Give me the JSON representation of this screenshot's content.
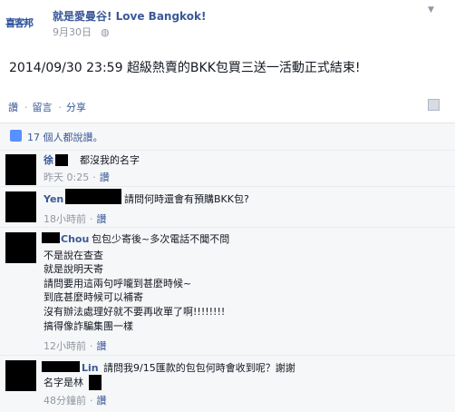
{
  "post": {
    "logo_text": "喜客邦",
    "page_name": "就是愛曼谷! Love Bangkok!",
    "date": "9月30日",
    "text": "2014/09/30 23:59 超級熱賣的BKK包買三送一活動正式結束!"
  },
  "actions": {
    "like": "讚",
    "comment": "留言",
    "share": "分享",
    "dot": "·"
  },
  "likes": {
    "count_text": "17 個人都說讚。"
  },
  "comments": [
    {
      "name": "徐",
      "text": "都沒我的名字",
      "time": "昨天 0:25",
      "like": "讚"
    },
    {
      "name": "Yen",
      "text": "請問何時還會有預購BKK包?",
      "time": "18小時前",
      "like": "讚"
    },
    {
      "name": "Chou",
      "lines": [
        "包包少寄後~多次電話不聞不問",
        "不是說在查查",
        "就是說明天寄",
        "請問要用這兩句呼嚨到甚麼時候~",
        "到底甚麼時候可以補寄",
        "沒有辦法處理好就不要再收單了啊!!!!!!!!",
        "搞得像詐騙集團一樣"
      ],
      "time": "12小時前",
      "like": "讚"
    },
    {
      "name": "Lin",
      "lines": [
        "請問我9/15匯款的包包何時會收到呢？謝謝",
        "名字是林"
      ],
      "time": "48分鐘前",
      "like": "讚"
    }
  ],
  "colors": {
    "link": "#3b5998",
    "muted": "#9197a3",
    "bg_gray": "#f6f7f8"
  }
}
